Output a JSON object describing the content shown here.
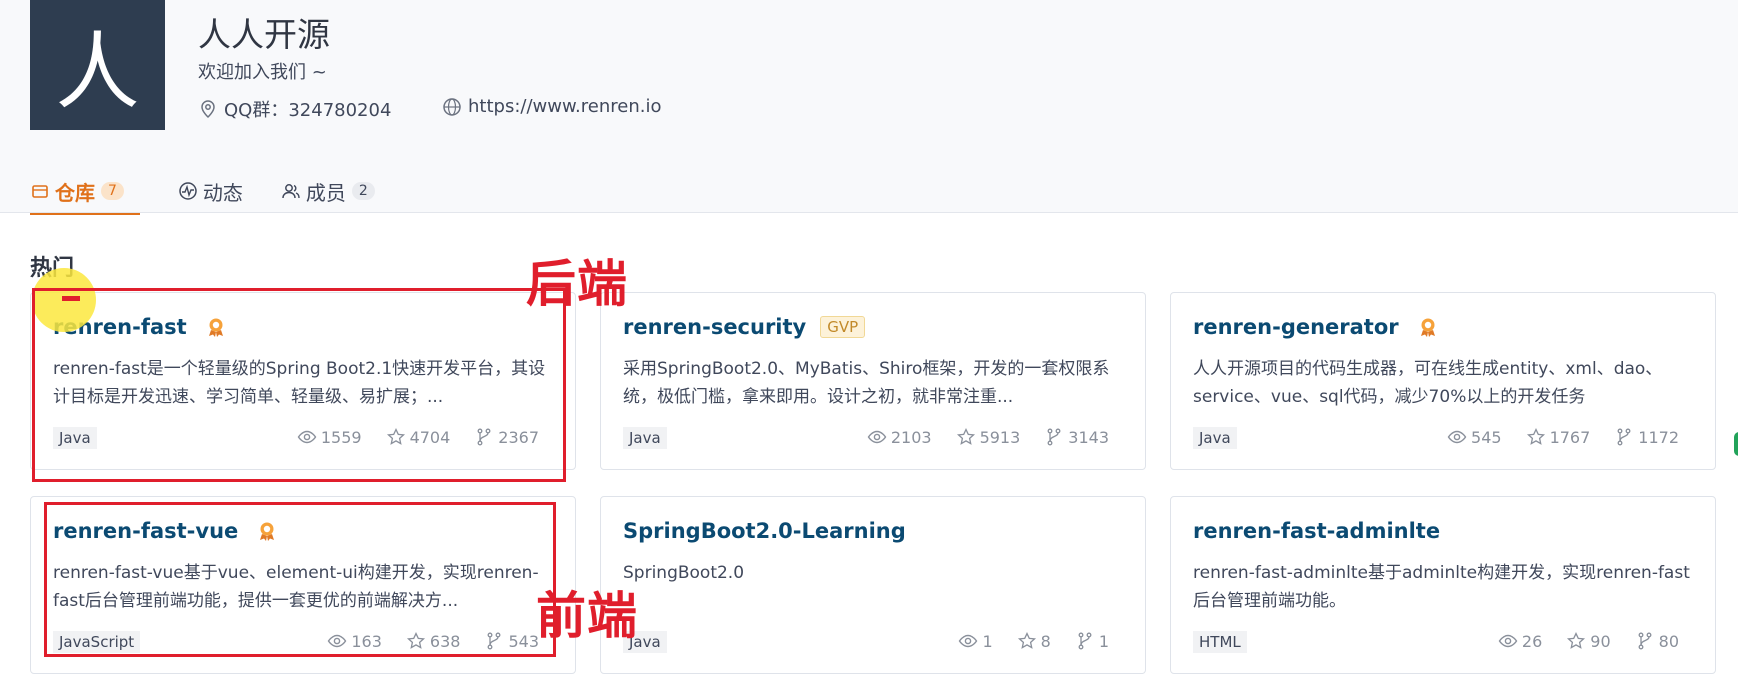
{
  "org": {
    "avatar_char": "人",
    "name": "人人开源",
    "description": "欢迎加入我们 ~",
    "qq": "QQ群：324780204",
    "website": "https://www.renren.io"
  },
  "tabs": [
    {
      "label": "仓库",
      "count": "7",
      "active": true
    },
    {
      "label": "动态",
      "count": "",
      "active": false
    },
    {
      "label": "成员",
      "count": "2",
      "active": false
    }
  ],
  "section": {
    "title": "热门"
  },
  "repos": [
    {
      "name": "renren-fast",
      "award": true,
      "gvp": "",
      "desc": "renren-fast是一个轻量级的Spring Boot2.1快速开发平台，其设计目标是开发迅速、学习简单、轻量级、易扩展；...",
      "lang": "Java",
      "watch": "1559",
      "star": "4704",
      "fork": "2367"
    },
    {
      "name": "renren-security",
      "award": false,
      "gvp": "GVP",
      "desc": "采用SpringBoot2.0、MyBatis、Shiro框架，开发的一套权限系统，极低门槛，拿来即用。设计之初，就非常注重...",
      "lang": "Java",
      "watch": "2103",
      "star": "5913",
      "fork": "3143"
    },
    {
      "name": "renren-generator",
      "award": true,
      "gvp": "",
      "desc": "人人开源项目的代码生成器，可在线生成entity、xml、dao、service、vue、sql代码，减少70%以上的开发任务",
      "lang": "Java",
      "watch": "545",
      "star": "1767",
      "fork": "1172"
    },
    {
      "name": "renren-fast-vue",
      "award": true,
      "gvp": "",
      "desc": "renren-fast-vue基于vue、element-ui构建开发，实现renren-fast后台管理前端功能，提供一套更优的前端解决方...",
      "lang": "JavaScript",
      "watch": "163",
      "star": "638",
      "fork": "543"
    },
    {
      "name": "SpringBoot2.0-Learning",
      "award": false,
      "gvp": "",
      "desc": "SpringBoot2.0",
      "lang": "Java",
      "watch": "1",
      "star": "8",
      "fork": "1"
    },
    {
      "name": "renren-fast-adminlte",
      "award": false,
      "gvp": "",
      "desc": "renren-fast-adminlte基于adminlte构建开发，实现renren-fast后台管理前端功能。",
      "lang": "HTML",
      "watch": "26",
      "star": "90",
      "fork": "80"
    }
  ],
  "annotations": {
    "backend": "后端",
    "frontend": "前端"
  },
  "colors": {
    "accent": "#e0711a",
    "repo_name": "#0b4a72",
    "annotation_red": "#e01e2c",
    "avatar_bg": "#2e3d50"
  }
}
